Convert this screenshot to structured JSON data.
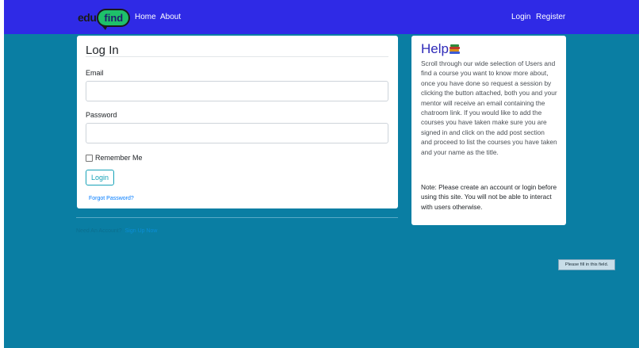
{
  "nav": {
    "brand_prefix": "edu",
    "brand_bubble": "find",
    "home": "Home",
    "about": "About",
    "login": "Login",
    "register": "Register"
  },
  "login_card": {
    "title": "Log In",
    "email_label": "Email",
    "email_value": "",
    "password_label": "Password",
    "password_value": "",
    "remember_label": "Remember Me",
    "remember_checked": false,
    "login_button": "Login",
    "forgot_link": "Forgot Password?"
  },
  "footer": {
    "need_account": "Need An Account?",
    "sign_up": "Sign Up Now"
  },
  "help": {
    "title": "Help",
    "icon": "books-icon",
    "body": "Scroll through our wide selection of Users and find a course you want to know more about, once you have done so request a session by clicking the button attached, both you and your mentor will receive an email containing the chatroom link. If you would like to add the courses you have taken make sure you are signed in and click on the add post section and proceed to list the courses you have taken and your name as the title.",
    "note": "Note: Please create an account or login before using this site. You will not be able to interact with users otherwise."
  },
  "tooltip": {
    "text": "Please fill in this field."
  },
  "colors": {
    "navbar": "#2f2ae6",
    "page_bg": "#0a7ea3",
    "accent": "#17a2b8",
    "link": "#007bff"
  }
}
